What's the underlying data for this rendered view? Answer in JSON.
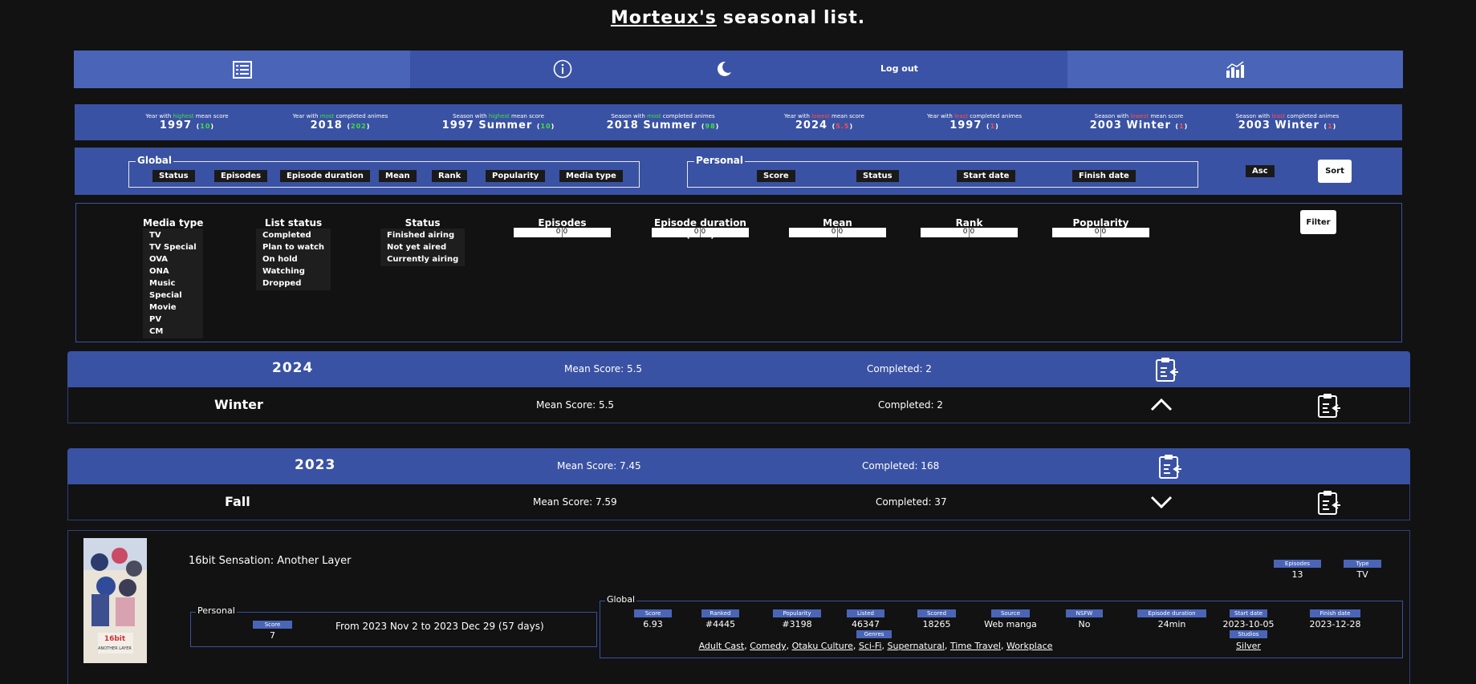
{
  "page": {
    "title_user": "Morteux's",
    "title_word2": "seasonal",
    "title_word3": "list."
  },
  "nav": {
    "list_icon": "list-icon",
    "info_icon": "info-icon",
    "moon_icon": "moon-icon",
    "logout_label": "Log out",
    "stats_icon": "bar-chart-icon"
  },
  "stats": [
    {
      "pre": "Year with ",
      "hl": "highest",
      "hl_color": "g",
      "post": " mean score",
      "value": "1997",
      "badge": "10",
      "badge_color": "g"
    },
    {
      "pre": "Year with ",
      "hl": "most",
      "hl_color": "g",
      "post": " completed animes",
      "value": "2018",
      "badge": "202",
      "badge_color": "g"
    },
    {
      "pre": "Season with ",
      "hl": "highest",
      "hl_color": "g",
      "post": " mean score",
      "value": "1997 Summer",
      "badge": "10",
      "badge_color": "g"
    },
    {
      "pre": "Season with ",
      "hl": "most",
      "hl_color": "g",
      "post": " completed animes",
      "value": "2018 Summer",
      "badge": "98",
      "badge_color": "g"
    },
    {
      "pre": "Year with ",
      "hl": "lowest",
      "hl_color": "r",
      "post": " mean score",
      "value": "2024",
      "badge": "5.5",
      "badge_color": "r"
    },
    {
      "pre": "Year with ",
      "hl": "least",
      "hl_color": "r",
      "post": " completed animes",
      "value": "1997",
      "badge": "1",
      "badge_color": "r"
    },
    {
      "pre": "Season with ",
      "hl": "lowest",
      "hl_color": "r",
      "post": " mean score",
      "value": "2003 Winter",
      "badge": "1",
      "badge_color": "r"
    },
    {
      "pre": "Season with ",
      "hl": "least",
      "hl_color": "r",
      "post": " completed animes",
      "value": "2003 Winter",
      "badge": "1",
      "badge_color": "r"
    }
  ],
  "sort": {
    "global_legend": "Global",
    "global_chips": [
      "Status",
      "Episodes",
      "Episode duration",
      "Mean",
      "Rank",
      "Popularity",
      "Media type"
    ],
    "personal_legend": "Personal",
    "personal_chips": [
      "Score",
      "Status",
      "Start date",
      "Finish date"
    ],
    "asc_label": "Asc",
    "sort_label": "Sort"
  },
  "filter": {
    "media_type": {
      "title": "Media type",
      "items": [
        "TV",
        "TV Special",
        "OVA",
        "ONA",
        "Music",
        "Special",
        "Movie",
        "PV",
        "CM"
      ]
    },
    "list_status": {
      "title": "List status",
      "items": [
        "Completed",
        "Plan to watch",
        "On hold",
        "Watching",
        "Dropped"
      ]
    },
    "status": {
      "title": "Status",
      "items": [
        "Finished airing",
        "Not yet aired",
        "Currently airing"
      ]
    },
    "ranges": [
      {
        "title": "Episodes",
        "min": "0",
        "max": "0"
      },
      {
        "title": "Episode duration (min)",
        "min": "0",
        "max": "0"
      },
      {
        "title": "Mean",
        "min": "0",
        "max": "0"
      },
      {
        "title": "Rank",
        "min": "0",
        "max": "0"
      },
      {
        "title": "Popularity",
        "min": "0",
        "max": "0"
      }
    ],
    "filter_label": "Filter"
  },
  "years": [
    {
      "year": "2024",
      "mean": "Mean Score: 5.5",
      "completed": "Completed: 2",
      "season": {
        "name": "Winter",
        "mean": "Mean Score: 5.5",
        "completed": "Completed: 2",
        "chevron": "chevron-up-icon"
      }
    },
    {
      "year": "2023",
      "mean": "Mean Score: 7.45",
      "completed": "Completed: 168",
      "season": {
        "name": "Fall",
        "mean": "Mean Score: 7.59",
        "completed": "Completed: 37",
        "chevron": "chevron-down-icon"
      }
    }
  ],
  "anime": {
    "title": "16bit Sensation: Another Layer",
    "episodes_label": "Episodes",
    "episodes": "13",
    "type_label": "Type",
    "type": "TV",
    "personal_legend": "Personal",
    "score_label": "Score",
    "score": "7",
    "date_range": "From 2023 Nov 2 to 2023 Dec 29 (57 days)",
    "global_legend": "Global",
    "global_stats": [
      {
        "label": "Score",
        "value": "6.93"
      },
      {
        "label": "Ranked",
        "value": "#4445"
      },
      {
        "label": "Popularity",
        "value": "#3198"
      },
      {
        "label": "Listed",
        "value": "46347"
      },
      {
        "label": "Scored",
        "value": "18265"
      },
      {
        "label": "Source",
        "value": "Web manga"
      },
      {
        "label": "NSFW",
        "value": "No"
      },
      {
        "label": "Episode duration",
        "value": "24min"
      },
      {
        "label": "Start date",
        "value": "2023-10-05"
      },
      {
        "label": "Finish date",
        "value": "2023-12-28"
      }
    ],
    "genres_label": "Genres",
    "genres": [
      "Adult Cast",
      "Comedy",
      "Otaku Culture",
      "Sci-Fi",
      "Supernatural",
      "Time Travel",
      "Workplace"
    ],
    "studios_label": "Studios",
    "studio": "Silver",
    "poster_text": "16bit センセーション ANOTHER LAYER"
  },
  "colors": {
    "accent": "#3a52a3",
    "accent_light": "#4a65b7",
    "bg": "#121212",
    "good": "#3fe03f",
    "bad": "#ff4b4b"
  }
}
